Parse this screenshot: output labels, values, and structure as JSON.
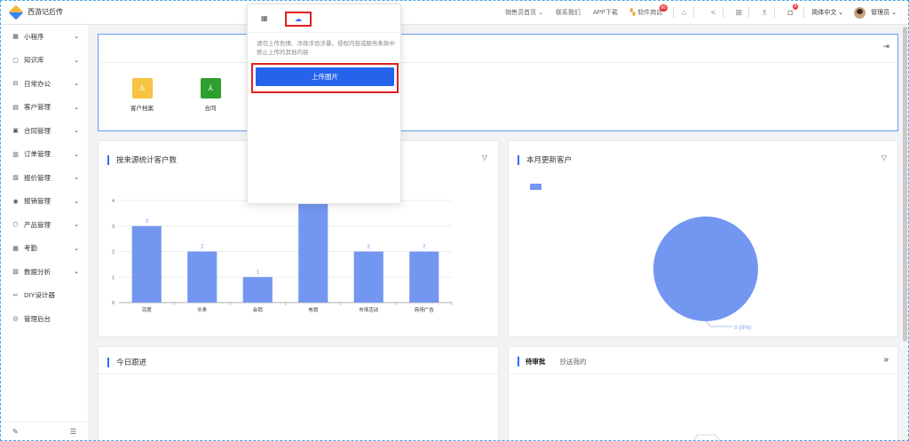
{
  "header": {
    "app_name": "西游记后传",
    "links": [
      "销售员首页",
      "联系我们",
      "APP下载",
      "软件商店"
    ],
    "apps_badge": "80",
    "notif_count": "9",
    "language": "简体中文",
    "user": "管理员"
  },
  "sidebar": {
    "items": [
      {
        "label": "小程序",
        "icon": "grid-icon",
        "glyph": "▦",
        "has_children": true
      },
      {
        "label": "知识库",
        "icon": "book-icon",
        "glyph": "▢",
        "has_children": true
      },
      {
        "label": "日常办公",
        "icon": "briefcase-icon",
        "glyph": "⊟",
        "has_children": true
      },
      {
        "label": "客户管理",
        "icon": "customer-icon",
        "glyph": "▤",
        "has_children": true
      },
      {
        "label": "合同管理",
        "icon": "contract-icon",
        "glyph": "▣",
        "has_children": true
      },
      {
        "label": "订单管理",
        "icon": "order-icon",
        "glyph": "▥",
        "has_children": true
      },
      {
        "label": "报价管理",
        "icon": "quote-icon",
        "glyph": "▧",
        "has_children": true
      },
      {
        "label": "报销管理",
        "icon": "reimburse-icon",
        "glyph": "◉",
        "has_children": true
      },
      {
        "label": "产品管理",
        "icon": "product-icon",
        "glyph": "⬡",
        "has_children": true
      },
      {
        "label": "考勤",
        "icon": "attendance-icon",
        "glyph": "▦",
        "has_children": true
      },
      {
        "label": "数据分析",
        "icon": "analytics-icon",
        "glyph": "▨",
        "has_children": true
      },
      {
        "label": "DIY设计器",
        "icon": "designer-icon",
        "glyph": "✂",
        "has_children": false
      },
      {
        "label": "管理后台",
        "icon": "settings-icon",
        "glyph": "◎",
        "has_children": false
      }
    ]
  },
  "quick_access": [
    {
      "label": "客户档案",
      "color": "#f6c342",
      "glyph": "♙"
    },
    {
      "label": "合同",
      "color": "#2e9e2e",
      "glyph": "⅄"
    }
  ],
  "chart_card": {
    "title": "按来源统计客户数"
  },
  "pie_card": {
    "title": "本月更新客户",
    "slice_label": "0 (0%)"
  },
  "follow_card": {
    "title": "今日跟进"
  },
  "approval_card": {
    "tabs": [
      "待审批",
      "抄送我的"
    ]
  },
  "upload_popup": {
    "note": "请勿上传色情、涉政涉恐涉暴、侵权内容或服务条款中禁止上传的其他内容",
    "button": "上传图片"
  },
  "chart_data": {
    "type": "bar",
    "categories": [
      "百度",
      "头条",
      "会销",
      "电销",
      "市场活动",
      "商场广告"
    ],
    "values": [
      3,
      2,
      1,
      4,
      2,
      2
    ],
    "data_labels": [
      "3",
      "2",
      "1",
      "",
      "2",
      "2"
    ],
    "title": "按来源统计客户数",
    "ylim": [
      0,
      4
    ],
    "yticks": [
      "0",
      "1",
      "2",
      "3",
      "4"
    ],
    "grid": true,
    "color": "#7396f0"
  }
}
